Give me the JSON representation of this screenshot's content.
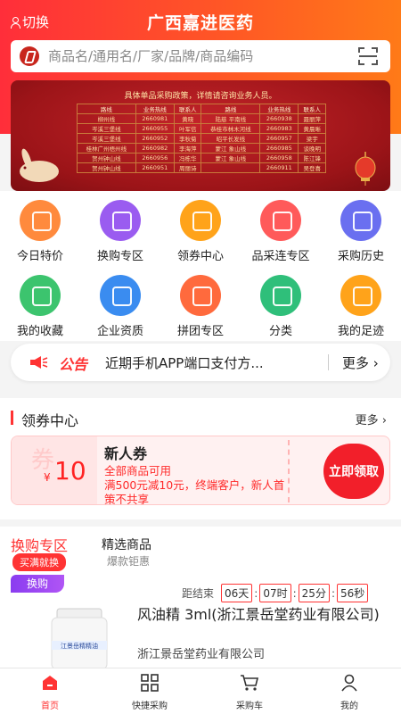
{
  "header": {
    "switch_label": "切换",
    "title": "广西嘉进医药",
    "search_placeholder": "商品名/通用名/厂家/品牌/商品编码"
  },
  "banner": {
    "notice": "具体单品采购政策，详情请咨询业务人员。",
    "headers": [
      "路线",
      "业务热线",
      "联系人",
      "路线",
      "业务热线",
      "联系人"
    ],
    "rows": [
      [
        "柳州线",
        "2660981",
        "黄晓",
        "陆慈 平南线",
        "2660938",
        "聂丽萍"
      ],
      [
        "岑溪三堡线",
        "2660955",
        "叶军信",
        "恭桂市林木河线",
        "2660983",
        "黄晨晰"
      ],
      [
        "岑溪三堡线",
        "2660952",
        "李秋菊",
        "昭平长发线",
        "2660957",
        "梁宇"
      ],
      [
        "桂林广州梧州线",
        "2660982",
        "李海萍",
        "蒙江 象山线",
        "2660985",
        "谈晚明"
      ],
      [
        "贺州钟山线",
        "2660956",
        "冯栋华",
        "蒙江 象山线",
        "2660958",
        "陈江锋"
      ],
      [
        "贺州钟山线",
        "2660951",
        "周丽诗",
        "",
        "2660911",
        "吴登喜"
      ]
    ]
  },
  "grid": [
    {
      "label": "今日特价",
      "color": "#ff8a3d"
    },
    {
      "label": "换购专区",
      "color": "#9a5cf0"
    },
    {
      "label": "领券中心",
      "color": "#ffa31a"
    },
    {
      "label": "品采连专区",
      "color": "#ff5a5a"
    },
    {
      "label": "采购历史",
      "color": "#6a6ff0"
    },
    {
      "label": "我的收藏",
      "color": "#3cc46e"
    },
    {
      "label": "企业资质",
      "color": "#3a8cf0"
    },
    {
      "label": "拼团专区",
      "color": "#ff6a3d"
    },
    {
      "label": "分类",
      "color": "#2fbf7a"
    },
    {
      "label": "我的足迹",
      "color": "#ffa31a"
    }
  ],
  "notice": {
    "tag": "公告",
    "message": "近期手机APP端口支付方...",
    "more": "更多 ›"
  },
  "coupon_center": {
    "title": "领券中心",
    "more": "更多 ›",
    "coupon": {
      "watermark": "券",
      "symbol": "¥",
      "amount": "10",
      "name": "新人券",
      "desc1": "全部商品可用",
      "desc2": "满500元减10元，终端客户，新人首",
      "desc3": "策不共享",
      "button": "立即领取"
    }
  },
  "exchange": {
    "tab_active": "换购专区",
    "tab_active_sub": "买满就换",
    "tab2": "精选商品",
    "tab2_sub": "爆款钜惠",
    "tag": "换购",
    "countdown_label": "距结束",
    "countdown": [
      "06天",
      "07时",
      "25分",
      "56秒"
    ],
    "product_name": "风油精 3ml(浙江景岳堂药业有限公司)",
    "product_company": "浙江景岳堂药业有限公司",
    "product_label": "江景岳精精油"
  },
  "tabbar": [
    {
      "label": "首页",
      "active": true
    },
    {
      "label": "快捷采购",
      "active": false
    },
    {
      "label": "采购车",
      "active": false
    },
    {
      "label": "我的",
      "active": false
    }
  ]
}
